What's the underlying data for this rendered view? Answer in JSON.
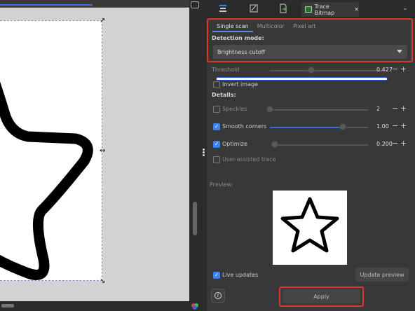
{
  "tabs": {
    "active_label": "Trace Bitmap",
    "close_glyph": "✕"
  },
  "mode_tabs": [
    "Single scan",
    "Multicolor",
    "Pixel art"
  ],
  "detection": {
    "heading": "Detection mode:",
    "selected": "Brightness cutoff"
  },
  "threshold": {
    "label": "Threshold",
    "value": "0.427",
    "level": 0.43
  },
  "invert": {
    "label": "Invert image",
    "checked": false
  },
  "details": {
    "heading": "Details:",
    "speckles": {
      "label": "Speckles",
      "value": "2",
      "checked": false,
      "level": 0.0
    },
    "smooth": {
      "label": "Smooth corners",
      "value": "1.00",
      "checked": true,
      "level": 0.75
    },
    "optimize": {
      "label": "Optimize",
      "value": "0.200",
      "checked": true,
      "level": 0.0
    }
  },
  "user_assisted": {
    "label": "User-assisted trace",
    "checked": false
  },
  "preview": {
    "label": "Preview:"
  },
  "live_updates": {
    "label": "Live updates",
    "checked": true
  },
  "buttons": {
    "update_preview": "Update preview",
    "apply": "Apply"
  },
  "colors": {
    "accent": "#3b82f6",
    "highlight": "#d93a2b",
    "panel_bg": "#383838"
  }
}
